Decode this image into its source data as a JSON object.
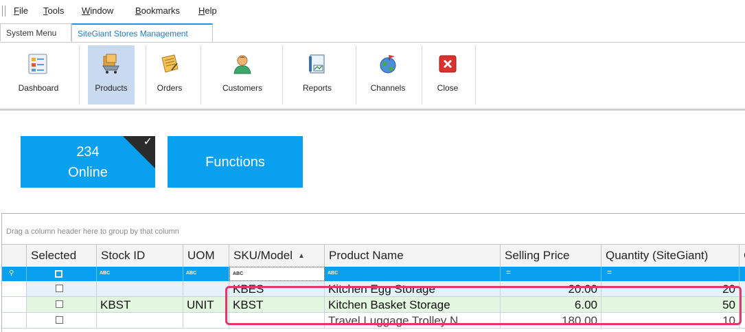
{
  "menu": {
    "items": [
      {
        "key": "F",
        "rest": "ile"
      },
      {
        "key": "T",
        "rest": "ools"
      },
      {
        "key": "W",
        "rest": "indow"
      },
      {
        "key": "B",
        "rest": "ookmarks"
      },
      {
        "key": "H",
        "rest": "elp"
      }
    ]
  },
  "tabs": {
    "system": "System Menu",
    "stores": "SiteGiant Stores Management"
  },
  "ribbon": {
    "dashboard": "Dashboard",
    "products": "Products",
    "orders": "Orders",
    "customers": "Customers",
    "reports": "Reports",
    "channels": "Channels",
    "close": "Close"
  },
  "tiles": {
    "online_count": "234",
    "online_label": "Online",
    "functions": "Functions"
  },
  "grid": {
    "group_hint": "Drag a column header here to group by that column",
    "columns": [
      "Selected",
      "Stock ID",
      "UOM",
      "SKU/Model",
      "Product Name",
      "Selling Price",
      "Quantity (SiteGiant)",
      "C"
    ],
    "sort_indicator": "▲",
    "rows": [
      {
        "stock_id": "",
        "uom": "",
        "sku": "KBES",
        "name": "Kitchen Egg Storage",
        "price": "20.00",
        "qty": "20"
      },
      {
        "stock_id": "KBST",
        "uom": "UNIT",
        "sku": "KBST",
        "name": "Kitchen Basket Storage",
        "price": "6.00",
        "qty": "50"
      },
      {
        "stock_id": "",
        "uom": "",
        "sku": "",
        "name": "Travel Luggage Trolley N",
        "price": "180.00",
        "qty": "10"
      }
    ]
  },
  "colors": {
    "tile_blue": "#0aa0f0",
    "tile_corner": "#2b2b2b",
    "highlight": "#e2376a",
    "active_ribbon": "#c9d9ef"
  },
  "icons": [
    "products-cart-icon",
    "orders-note-icon",
    "customers-person-icon",
    "reports-chart-icon",
    "channels-globe-icon",
    "close-x-icon",
    "dashboard-list-icon"
  ]
}
